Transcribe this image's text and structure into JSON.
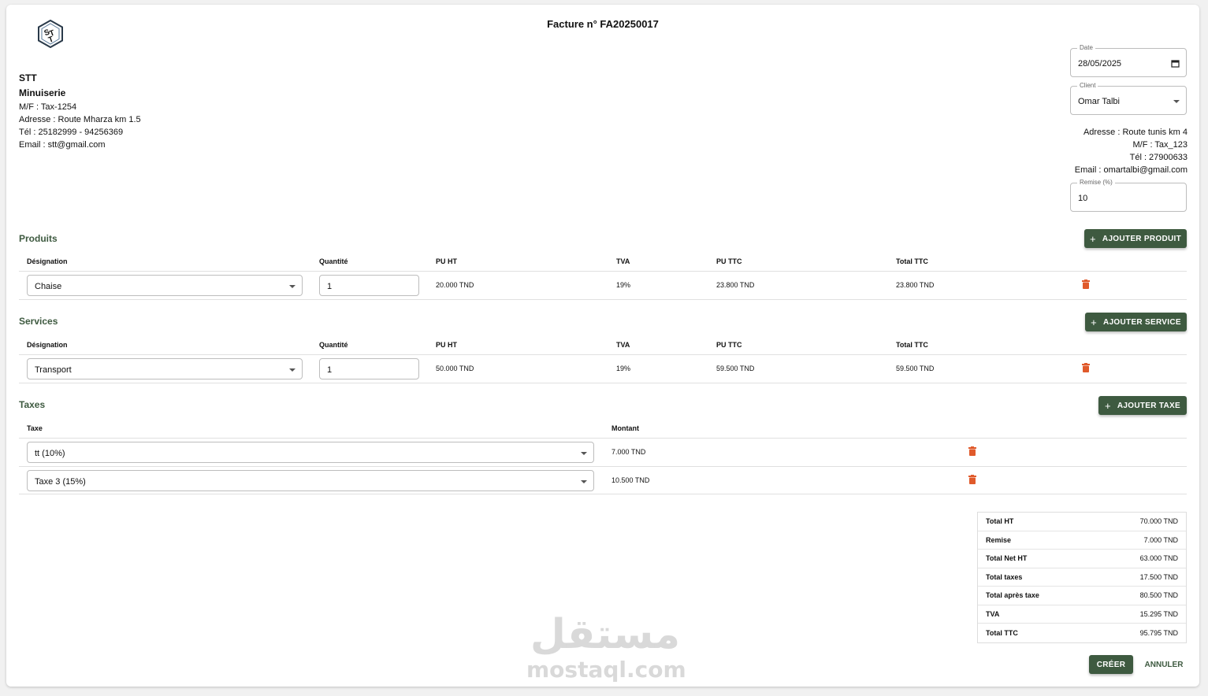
{
  "invoice": {
    "title": "Facture n° FA20250017"
  },
  "company": {
    "name": "STT",
    "activity": "Minuiserie",
    "mf": "M/F : Tax-1254",
    "address": "Adresse : Route Mharza km 1.5",
    "tel": "Tél : 25182999 - 94256369",
    "email": "Email : stt@gmail.com"
  },
  "date_field": {
    "label": "Date",
    "value": "28/05/2025"
  },
  "client_field": {
    "label": "Client",
    "value": "Omar Talbi"
  },
  "client_info": {
    "address": "Adresse : Route tunis km 4",
    "mf": "M/F : Tax_123",
    "tel": "Tél : 27900633",
    "email": "Email : omartalbi@gmail.com"
  },
  "remise_field": {
    "label": "Remise (%)",
    "value": "10"
  },
  "products": {
    "title": "Produits",
    "add_button": "AJOUTER PRODUIT",
    "headers": [
      "Désignation",
      "Quantité",
      "PU HT",
      "TVA",
      "PU TTC",
      "Total TTC"
    ],
    "rows": [
      {
        "designation": "Chaise",
        "quantity": "1",
        "pu_ht": "20.000 TND",
        "tva": "19%",
        "pu_ttc": "23.800 TND",
        "total_ttc": "23.800 TND"
      }
    ]
  },
  "services": {
    "title": "Services",
    "add_button": "AJOUTER SERVICE",
    "headers": [
      "Désignation",
      "Quantité",
      "PU HT",
      "TVA",
      "PU TTC",
      "Total TTC"
    ],
    "rows": [
      {
        "designation": "Transport",
        "quantity": "1",
        "pu_ht": "50.000 TND",
        "tva": "19%",
        "pu_ttc": "59.500 TND",
        "total_ttc": "59.500 TND"
      }
    ]
  },
  "taxes": {
    "title": "Taxes",
    "add_button": "AJOUTER TAXE",
    "headers": [
      "Taxe",
      "Montant"
    ],
    "rows": [
      {
        "taxe": "tt (10%)",
        "montant": "7.000 TND"
      },
      {
        "taxe": "Taxe 3 (15%)",
        "montant": "10.500 TND"
      }
    ]
  },
  "summary": [
    {
      "label": "Total HT",
      "value": "70.000 TND"
    },
    {
      "label": "Remise",
      "value": "7.000 TND"
    },
    {
      "label": "Total Net HT",
      "value": "63.000 TND"
    },
    {
      "label": "Total taxes",
      "value": "17.500 TND"
    },
    {
      "label": "Total après taxe",
      "value": "80.500 TND"
    },
    {
      "label": "TVA",
      "value": "15.295 TND"
    },
    {
      "label": "Total TTC",
      "value": "95.795 TND"
    }
  ],
  "actions": {
    "create": "CRÉER",
    "cancel": "ANNULER"
  },
  "watermark": {
    "arabic": "مستقل",
    "latin": "mostaql.com"
  },
  "colors": {
    "accent": "#3e5a40",
    "delete": "#e05a2b"
  }
}
